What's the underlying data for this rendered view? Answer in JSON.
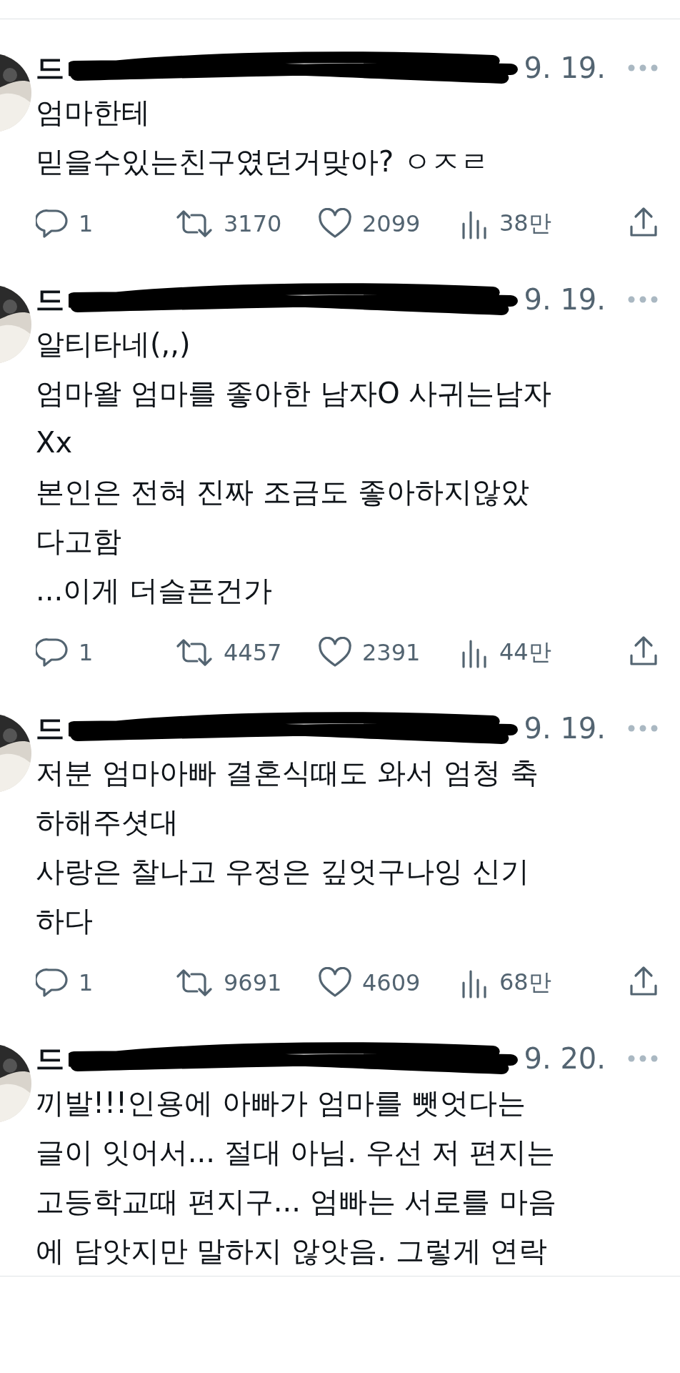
{
  "tweets": [
    {
      "name_visible": "드",
      "date": "9. 19.",
      "lines": [
        "엄마한테",
        "믿을수있는친구였던거맞아? ㅇㅈㄹ"
      ],
      "stats": {
        "replies": "1",
        "retweets": "3170",
        "likes": "2099",
        "views": "38만"
      }
    },
    {
      "name_visible": "드",
      "date": "9. 19.",
      "lines": [
        "알티타네(,,)",
        "엄마왈 엄마를 좋아한 남자O 사귀는남자",
        "Xx",
        "본인은 전혀 진짜 조금도 좋아하지않았",
        "다고함",
        "...이게 더슬픈건가"
      ],
      "stats": {
        "replies": "1",
        "retweets": "4457",
        "likes": "2391",
        "views": "44만"
      }
    },
    {
      "name_visible": "드",
      "date": "9. 19.",
      "lines": [
        "저분 엄마아빠 결혼식때도 와서 엄청 축",
        "하해주셧대",
        "사랑은 찰나고 우정은 깊엇구나잉 신기",
        "하다"
      ],
      "stats": {
        "replies": "1",
        "retweets": "9691",
        "likes": "4609",
        "views": "68만"
      }
    },
    {
      "name_visible": "드",
      "date": "9. 20.",
      "lines": [
        "끼발!!!인용에 아빠가 엄마를 뺏엇다는",
        "글이 잇어서... 절대 아님. 우선 저 편지는",
        "고등학교때 편지구... 엄빠는 서로를 마음",
        "에 담앗지만 말하지 않앗음. 그렇게 연락"
      ]
    }
  ]
}
